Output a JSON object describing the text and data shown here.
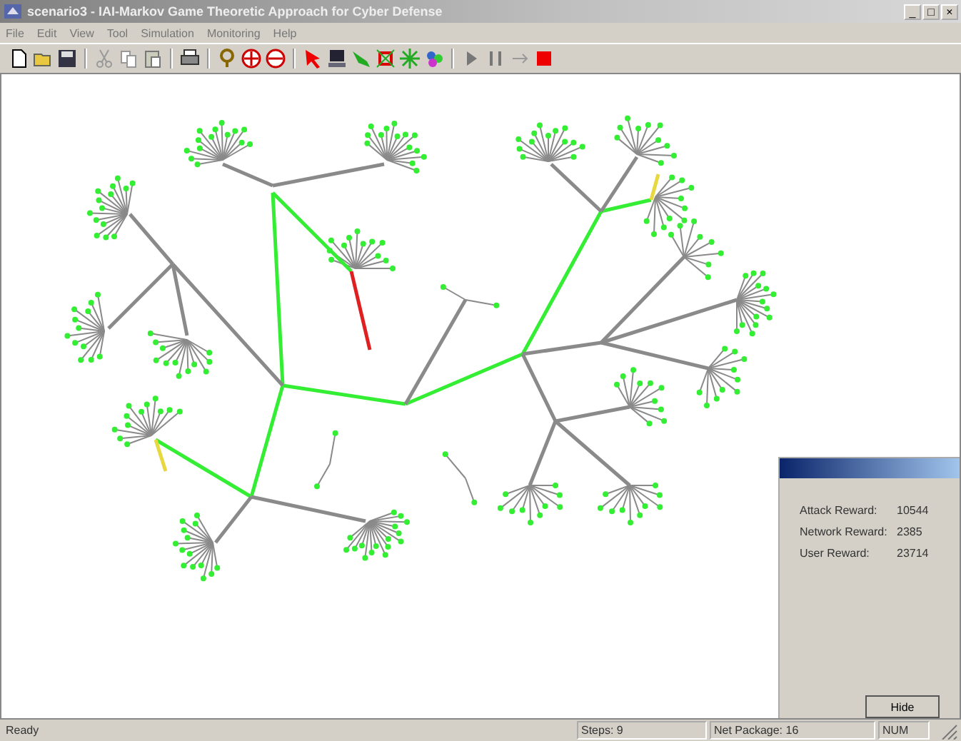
{
  "window": {
    "title": "scenario3 - IAI-Markov Game Theoretic Approach for Cyber Defense",
    "controls": [
      "_",
      "□",
      "×"
    ]
  },
  "menu": [
    "File",
    "Edit",
    "View",
    "Tool",
    "Simulation",
    "Monitoring",
    "Help"
  ],
  "rewards_panel": {
    "rows": [
      {
        "label": "Attack Reward:",
        "value": "10544"
      },
      {
        "label": "Network Reward:",
        "value": "2385"
      },
      {
        "label": "User Reward:",
        "value": "23714"
      }
    ],
    "button": "Hide"
  },
  "status_bar": {
    "message": "Ready",
    "steps": "Steps: 9",
    "net_package": "Net Package: 16",
    "num": "NUM"
  }
}
